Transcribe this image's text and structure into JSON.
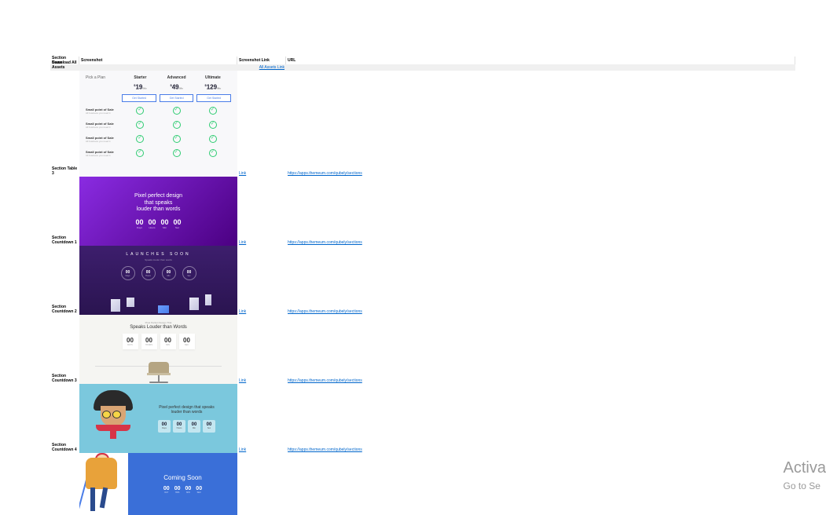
{
  "headers": {
    "a": "Section Name",
    "b": "Screenshot",
    "c": "Screenshot Link",
    "d": "URL"
  },
  "download_row": {
    "a": "Download All Assets",
    "c_link": "All Assets Link"
  },
  "rows": [
    {
      "a": "Section Table 3",
      "c": "Link",
      "d": "https://apps.themeum.com/qubely/sections"
    },
    {
      "a": "Section Countdown 1",
      "c": "Link",
      "d": "https://apps.themeum.com/qubely/sections"
    },
    {
      "a": "Section Countdown 2",
      "c": "Link",
      "d": "https://apps.themeum.com/qubely/sections"
    },
    {
      "a": "Section Countdown 3",
      "c": "Link",
      "d": "https://apps.themeum.com/qubely/sections"
    },
    {
      "a": "Section Countdown 4",
      "c": "Link",
      "d": "https://apps.themeum.com/qubely/sections"
    }
  ],
  "pricing": {
    "pick": "Pick a Plan",
    "plans": [
      "Starter",
      "Advanced",
      "Ultimate"
    ],
    "currency": "$",
    "prices": [
      "19",
      "49",
      "129"
    ],
    "period": "/Mo",
    "cta": "Get Started",
    "feat_title": "Small point of Sale",
    "feat_sub": "All business you need it"
  },
  "cd1": {
    "title_l1": "Pixel perfect design",
    "title_l2": "that speaks",
    "title_l3": "louder than words",
    "num": "00",
    "labels": [
      "Days",
      "Hours",
      "Min",
      "Sec"
    ]
  },
  "cd2": {
    "title": "LAUNCHES SOON",
    "sub": "Speaks louder than words",
    "num": "00",
    "labels": [
      "Days",
      "Hours",
      "Min",
      "Sec"
    ]
  },
  "cd3": {
    "pre": "Pixel Perfect Design That",
    "title": "Speaks Louder than Words",
    "num": "00",
    "labels": [
      "DAYS",
      "HOURS",
      "MIN",
      "SEC"
    ]
  },
  "cd4": {
    "title_l1": "Pixel perfect design that speaks",
    "title_l2": "louder than words",
    "num": "00",
    "labels": [
      "Days",
      "Hours",
      "Min",
      "Sec"
    ]
  },
  "cd5": {
    "title": "Coming Soon",
    "num": "00",
    "labels": [
      "DAY",
      "HRS",
      "MIN",
      "SEC"
    ]
  },
  "watermark": {
    "l1": "Activa",
    "l2": "Go to Se"
  }
}
